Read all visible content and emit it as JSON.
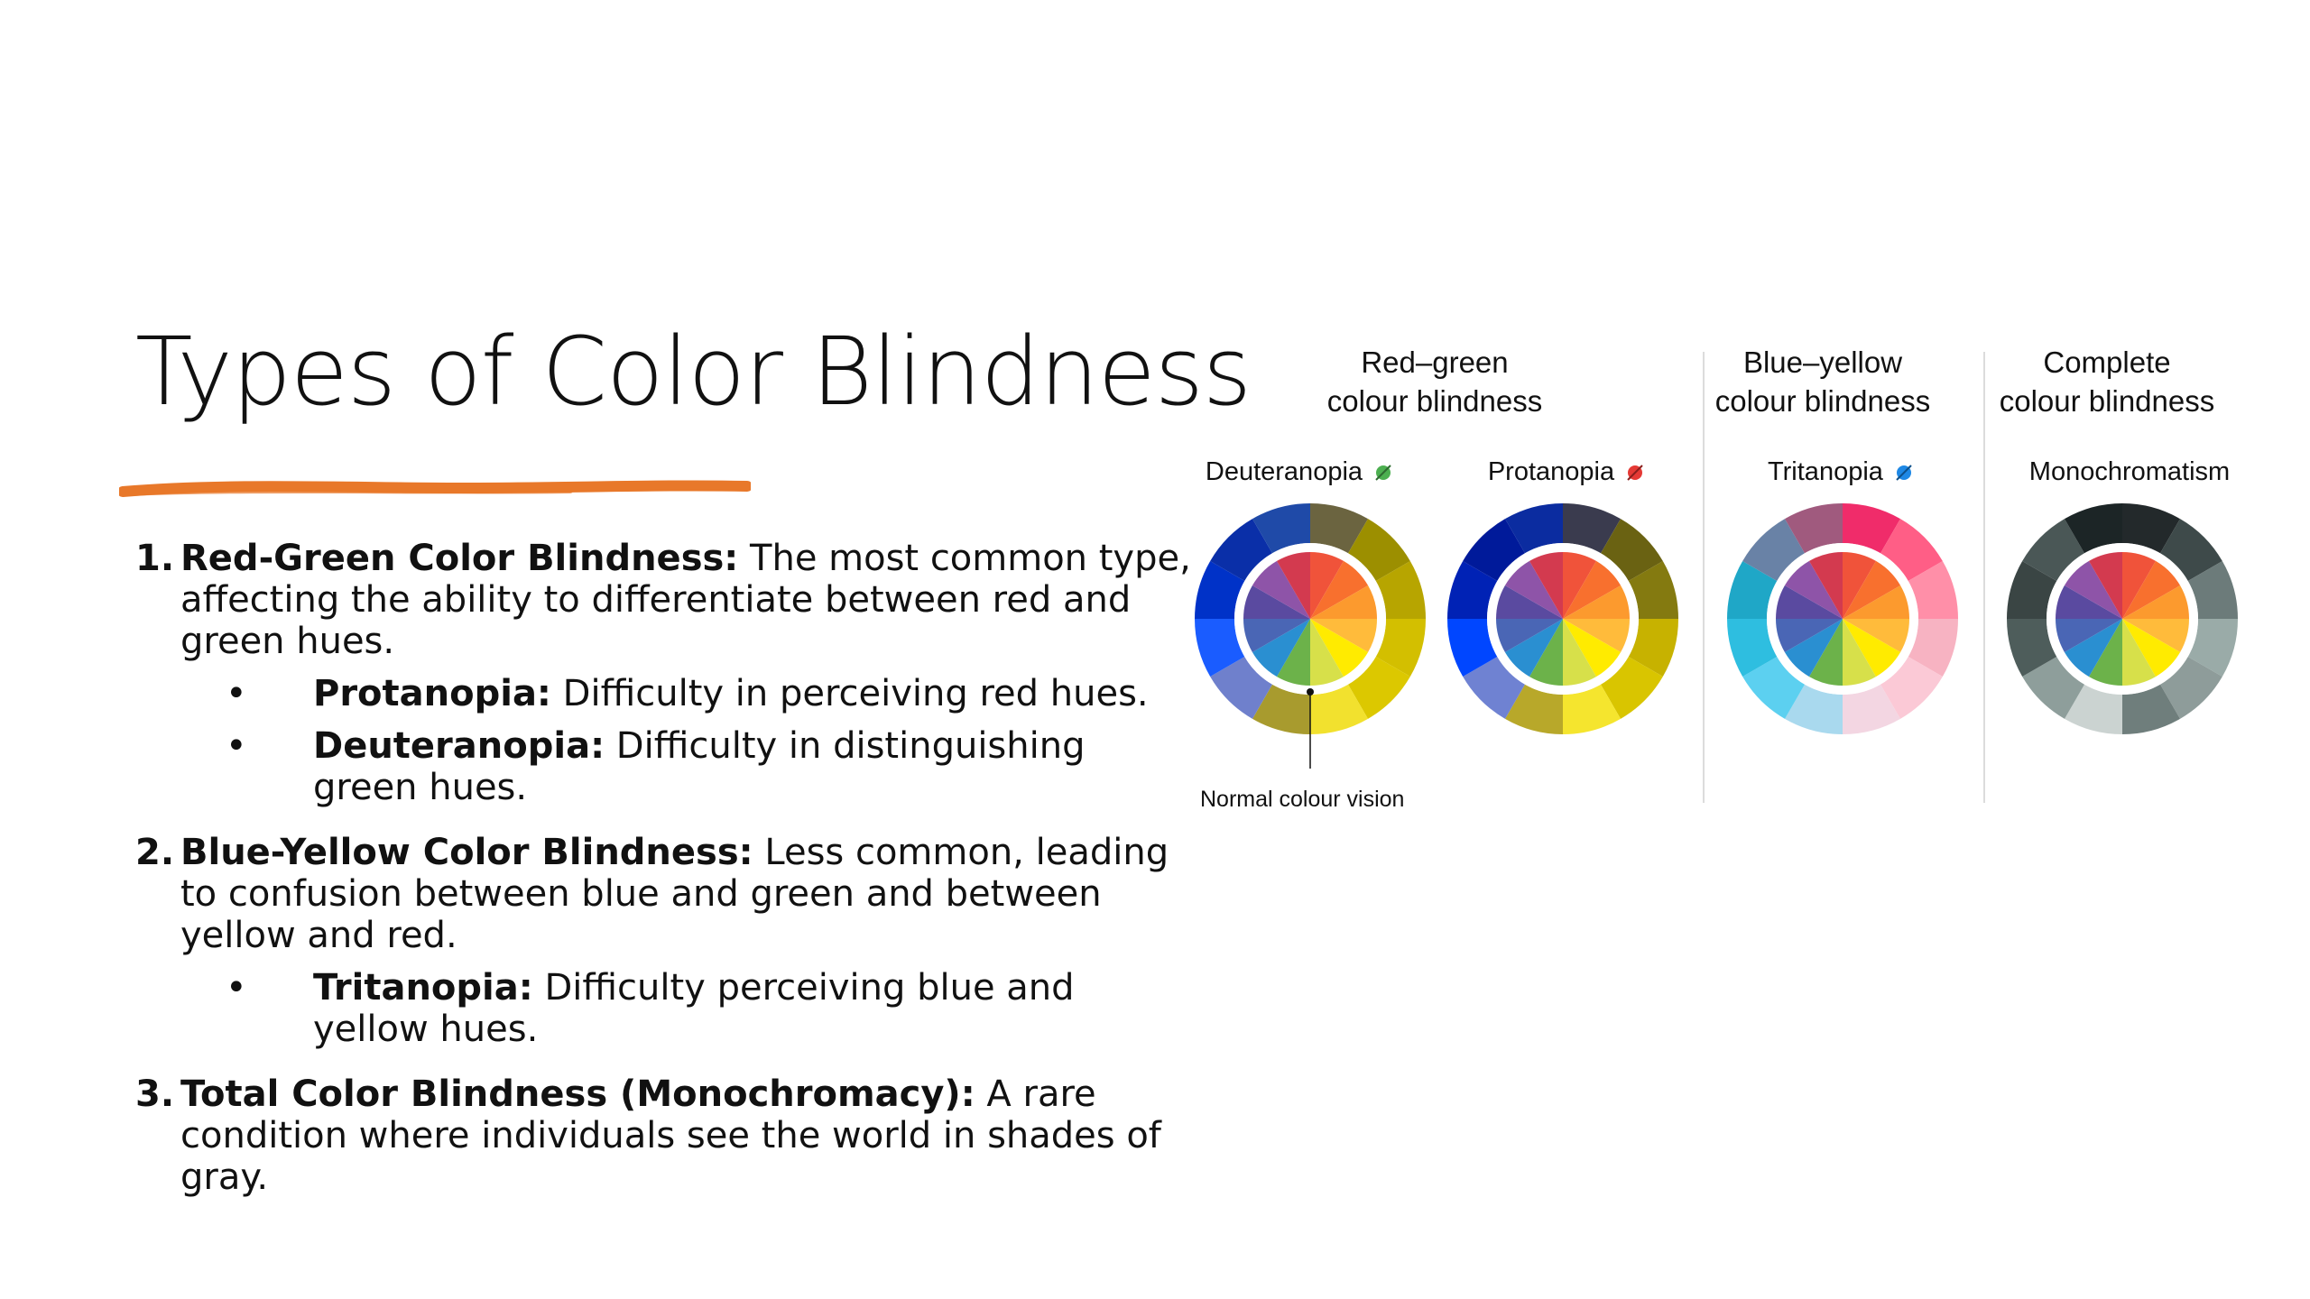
{
  "slide": {
    "title": "Types of Color Blindness",
    "accent_color": "#E8782A"
  },
  "list": [
    {
      "num": "1.",
      "heading": "Red-Green Color Blindness:",
      "text": " The most common type, affecting the ability to differentiate between red and green hues.",
      "subs": [
        {
          "heading": "Protanopia:",
          "text": " Difficulty in perceiving red hues."
        },
        {
          "heading": "Deuteranopia:",
          "text": " Difficulty in distinguishing green hues."
        }
      ]
    },
    {
      "num": "2.",
      "heading": "Blue-Yellow Color Blindness:",
      "text": " Less common, leading to confusion between blue and green and between yellow and red.",
      "subs": [
        {
          "heading": "Tritanopia:",
          "text": " Difficulty perceiving blue and yellow hues."
        }
      ]
    },
    {
      "num": "3.",
      "heading": "Total Color Blindness (Monochromacy):",
      "text": " A rare condition where individuals see the world in shades of gray.",
      "subs": []
    }
  ],
  "figure": {
    "groups": [
      {
        "line1": "Red–green",
        "line2": "colour blindness"
      },
      {
        "line1": "Blue–yellow",
        "line2": "colour blindness"
      },
      {
        "line1": "Complete",
        "line2": "colour blindness"
      }
    ],
    "wheels": [
      {
        "label": "Deuteranopia",
        "icon": "green-eye-icon",
        "icon_color": "#4CAF50",
        "outer": [
          "#6B6440",
          "#9C8F00",
          "#B7A500",
          "#D3BF00",
          "#DCC800",
          "#F2E12E",
          "#A89B2E",
          "#6F80CC",
          "#1A5CFF",
          "#0032C8",
          "#0A2FA8",
          "#1F4AA8"
        ]
      },
      {
        "label": "Protanopia",
        "icon": "red-eye-icon",
        "icon_color": "#E53935",
        "outer": [
          "#3A3B4E",
          "#6A6212",
          "#847A10",
          "#C7B200",
          "#D9C500",
          "#F5E52E",
          "#B8A82A",
          "#6F82D2",
          "#0046FF",
          "#0022B5",
          "#001A9A",
          "#0B2CA0"
        ]
      },
      {
        "label": "Tritanopia",
        "icon": "blue-eye-icon",
        "icon_color": "#1E88E5",
        "outer": [
          "#F02C6A",
          "#FF5E86",
          "#FF8FA8",
          "#F7B3C2",
          "#FBC9D6",
          "#F3D6E2",
          "#A9D9EE",
          "#5CD0F0",
          "#2EBEE0",
          "#1FA7C7",
          "#6982A6",
          "#A05A7E"
        ]
      },
      {
        "label": "Monochromatism",
        "icon": "",
        "icon_color": "",
        "outer": [
          "#23292B",
          "#3E4A4A",
          "#6C7B7A",
          "#9AABA8",
          "#8E9C9A",
          "#6F7E7C",
          "#CBD3D1",
          "#8E9E9B",
          "#4E5D5B",
          "#3A4544",
          "#4A5756",
          "#1C2526"
        ]
      }
    ],
    "inner": [
      "#F0533A",
      "#F8702E",
      "#FC9A2E",
      "#FFBB3B",
      "#FFEB00",
      "#D7E04A",
      "#6CB24A",
      "#2A8FD1",
      "#4A66B5",
      "#5A4AA0",
      "#8E54A8",
      "#D33A4F"
    ],
    "normal_label": "Normal colour vision"
  }
}
